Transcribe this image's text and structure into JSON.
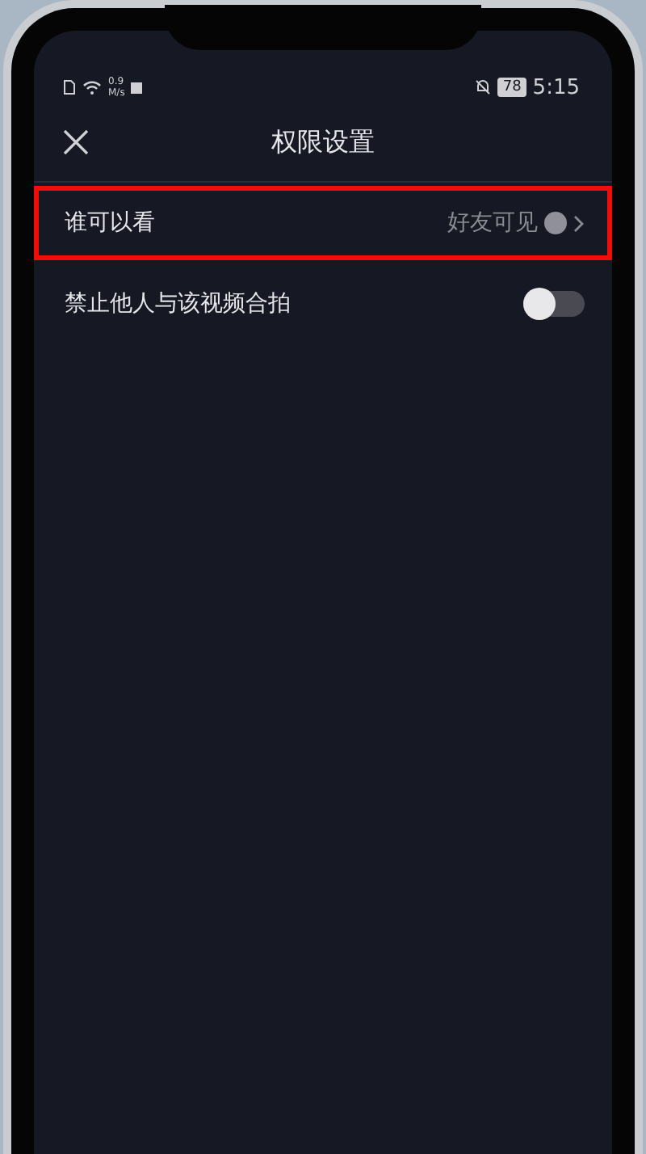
{
  "status_bar": {
    "network_speed": "0.9",
    "speed_unit": "M/s",
    "battery": "78",
    "time": "5:15"
  },
  "header": {
    "title": "权限设置"
  },
  "settings": [
    {
      "kind": "link",
      "label": "谁可以看",
      "value": "好友可见",
      "highlighted": true
    },
    {
      "kind": "toggle",
      "label": "禁止他人与该视频合拍",
      "on": false
    }
  ]
}
